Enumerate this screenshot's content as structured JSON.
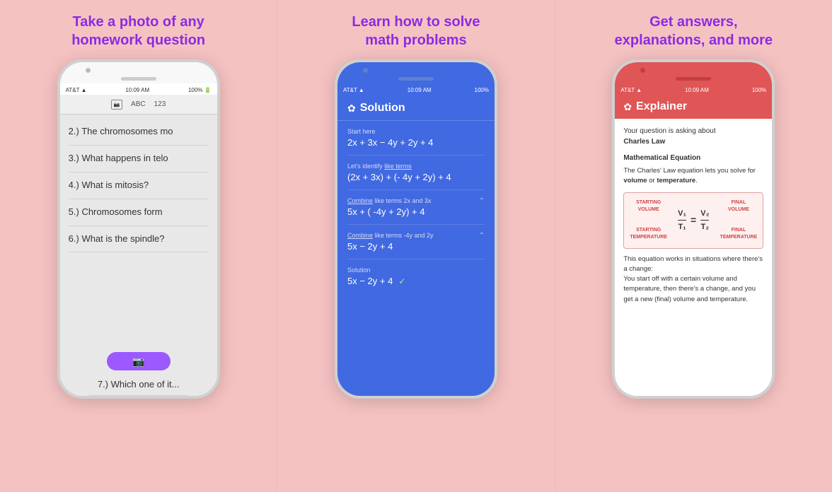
{
  "background_color": "#f5c2c2",
  "accent_color": "#8b2be2",
  "panels": [
    {
      "id": "panel1",
      "title": "Take a photo of any\nhomework question",
      "phone": {
        "status": {
          "carrier": "AT&T",
          "signal": "▲",
          "wifi": "wifi",
          "time": "10:09 AM",
          "battery": "100%"
        },
        "toolbar": [
          "ABC",
          "123"
        ],
        "questions": [
          "2.) The chromosomes mo",
          "3.) What happens in telo",
          "4.) What is mitosis?",
          "5.) Chromosomes form",
          "6.) What is the spindle?"
        ],
        "camera_button_icon": "📷"
      }
    },
    {
      "id": "panel2",
      "title": "Learn how to solve\nmath problems",
      "phone": {
        "status": {
          "carrier": "AT&T",
          "signal": "▲",
          "wifi": "wifi",
          "time": "10:09 AM",
          "battery": "100%"
        },
        "solution_header": "Solution",
        "steps": [
          {
            "label": "Start here",
            "equation": "2x + 3x − 4y + 2y + 4",
            "has_link": false
          },
          {
            "label": "Let's identify like terms",
            "equation": "(2x + 3x) + (- 4y + 2y) + 4",
            "has_link": true
          },
          {
            "label": "Combine like terms 2x and 3x",
            "equation": "5x + ( -4y + 2y) + 4",
            "has_chevron": true,
            "has_link": true
          },
          {
            "label": "Combine like terms -4y and 2y",
            "equation": "5x − 2y + 4",
            "has_chevron": true,
            "has_link": true
          },
          {
            "label": "Solution",
            "equation": "5x − 2y + 4",
            "is_final": true,
            "has_link": false
          }
        ]
      }
    },
    {
      "id": "panel3",
      "title": "Get answers,\nexplanations, and more",
      "phone": {
        "status": {
          "carrier": "AT&T",
          "signal": "▲",
          "wifi": "wifi",
          "time": "10:09 AM",
          "battery": "100%"
        },
        "explainer_header": "Explainer",
        "intro": "Your question is asking about",
        "topic_bold": "Charles Law",
        "section_title": "Mathematical Equation",
        "description": "The Charles' Law equation lets you solve for",
        "description_bold1": "volume",
        "description_mid": "or",
        "description_bold2": "temperature",
        "description_end": ".",
        "diagram": {
          "left_top": "STARTING\nVOLUME",
          "left_bottom": "STARTING\nTEMPERATURE",
          "right_top": "FINAL\nVOLUME",
          "right_bottom": "FINAL\nTEMPERATURE",
          "left_fraction": {
            "num": "V₁",
            "den": "T₁"
          },
          "right_fraction": {
            "num": "V₂",
            "den": "T₂"
          },
          "equals": "="
        },
        "explanation": "This equation works in situations where there's a change:\nYou start off with a certain volume and temperature, then there's a change, and you get a new (final) volume and temperature."
      }
    }
  ]
}
